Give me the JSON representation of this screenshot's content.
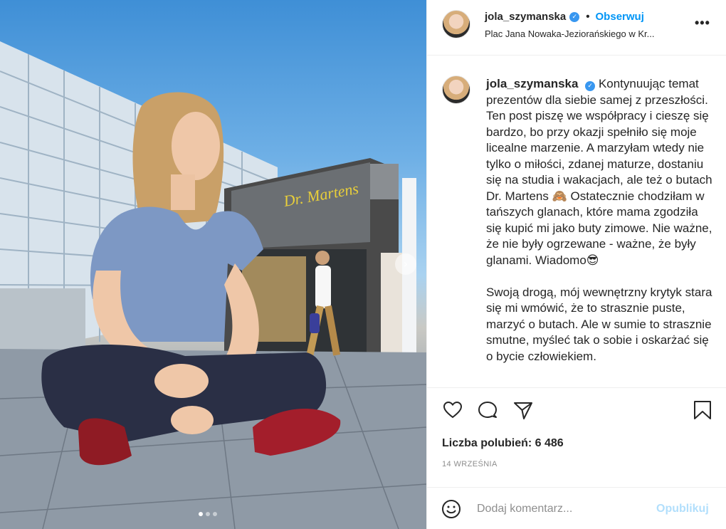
{
  "post": {
    "username": "jola_szymanska",
    "verified_icon": "verified-badge-icon",
    "follow_label": "Obserwuj",
    "separator": "•",
    "location": "Plac Jana Nowaka-Jeziorańskiego w Kr...",
    "more_label": "•••"
  },
  "caption": {
    "username": "jola_szymanska",
    "paragraph1": "Kontynuując temat prezentów dla siebie samej z przeszłości. Ten post piszę we współpracy i cieszę się bardzo, bo przy okazji spełniło się moje licealne marzenie. A marzyłam wtedy nie tylko o miłości, zdanej maturze, dostaniu się na studia i wakacjach, ale też o butach Dr. Martens 🙈 Ostatecznie chodziłam w tańszych glanach, które mama zgodziła się kupić mi jako buty zimowe. Nie ważne, że nie były ogrzewane - ważne, że były glanami. Wiadomo😎",
    "paragraph2": "Swoją drogą, mój wewnętrzny krytyk stara się mi wmówić, że to strasznie puste, marzyć o butach. Ale w sumie to strasznie smutne, myśleć tak o sobie i oskarżać się o bycie człowiekiem."
  },
  "actions": {
    "icons": [
      "heart-icon",
      "comment-icon",
      "share-icon",
      "bookmark-icon"
    ]
  },
  "likes_text": "Liczba polubień: 6 486",
  "date_text": "14 WRZEŚNIA",
  "comment": {
    "placeholder": "Dodaj komentarz...",
    "publish_label": "Opublikuj",
    "publish_color": "#b2dffc"
  },
  "photo": {
    "carousel_next_label": "›",
    "carousel_total": 3,
    "carousel_current": 1,
    "shop_sign": "Dr. Martens"
  },
  "colors": {
    "link_blue": "#0095f6",
    "text": "#262626",
    "muted": "#8e8e8e",
    "border": "#efefef"
  }
}
